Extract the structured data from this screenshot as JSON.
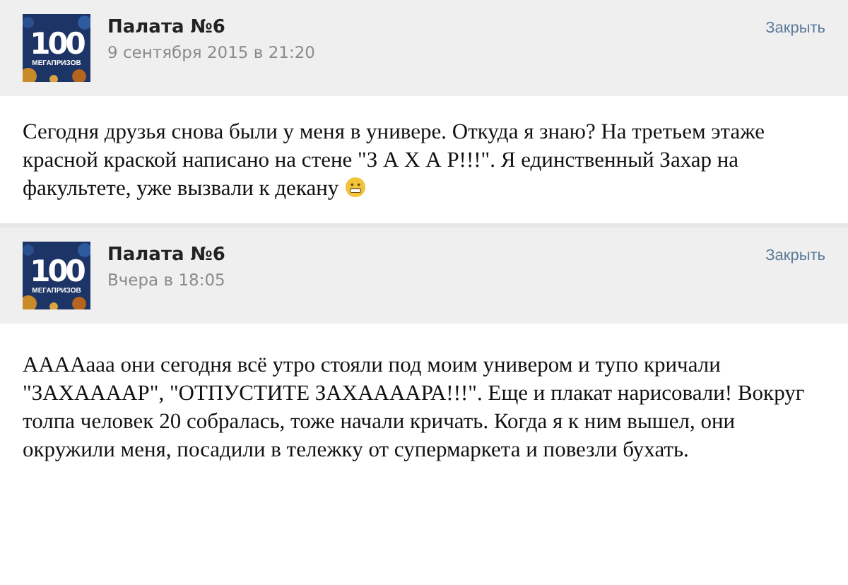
{
  "posts": [
    {
      "avatar": {
        "number": "100",
        "caption": "МЕГАПРИЗОВ"
      },
      "author": "Палата №6",
      "date": "9 сентября 2015 в 21:20",
      "close": "Закрыть",
      "text": "Сегодня друзья снова были у меня в универе. Откуда я знаю? На третьем этаже красной краской написано на стене \"З А Х А Р!!!\". Я единственный Захар на факультете, уже вызвали к декану",
      "emoji": true
    },
    {
      "avatar": {
        "number": "100",
        "caption": "МЕГАПРИЗОВ"
      },
      "author": "Палата №6",
      "date": "Вчера в 18:05",
      "close": "Закрыть",
      "text": "АААAааа они сегодня всё утро стояли под моим универом и тупо кричали \"ЗАХААААР\", \"ОТПУСТИТЕ ЗАХААААРА!!!\". Еще и плакат нарисовали! Вокруг толпа человек 20 собралась, тоже начали кричать. Когда я к ним вышел, они окружили меня, посадили в тележку от супермаркета и повезли бухать.",
      "emoji": false
    }
  ]
}
